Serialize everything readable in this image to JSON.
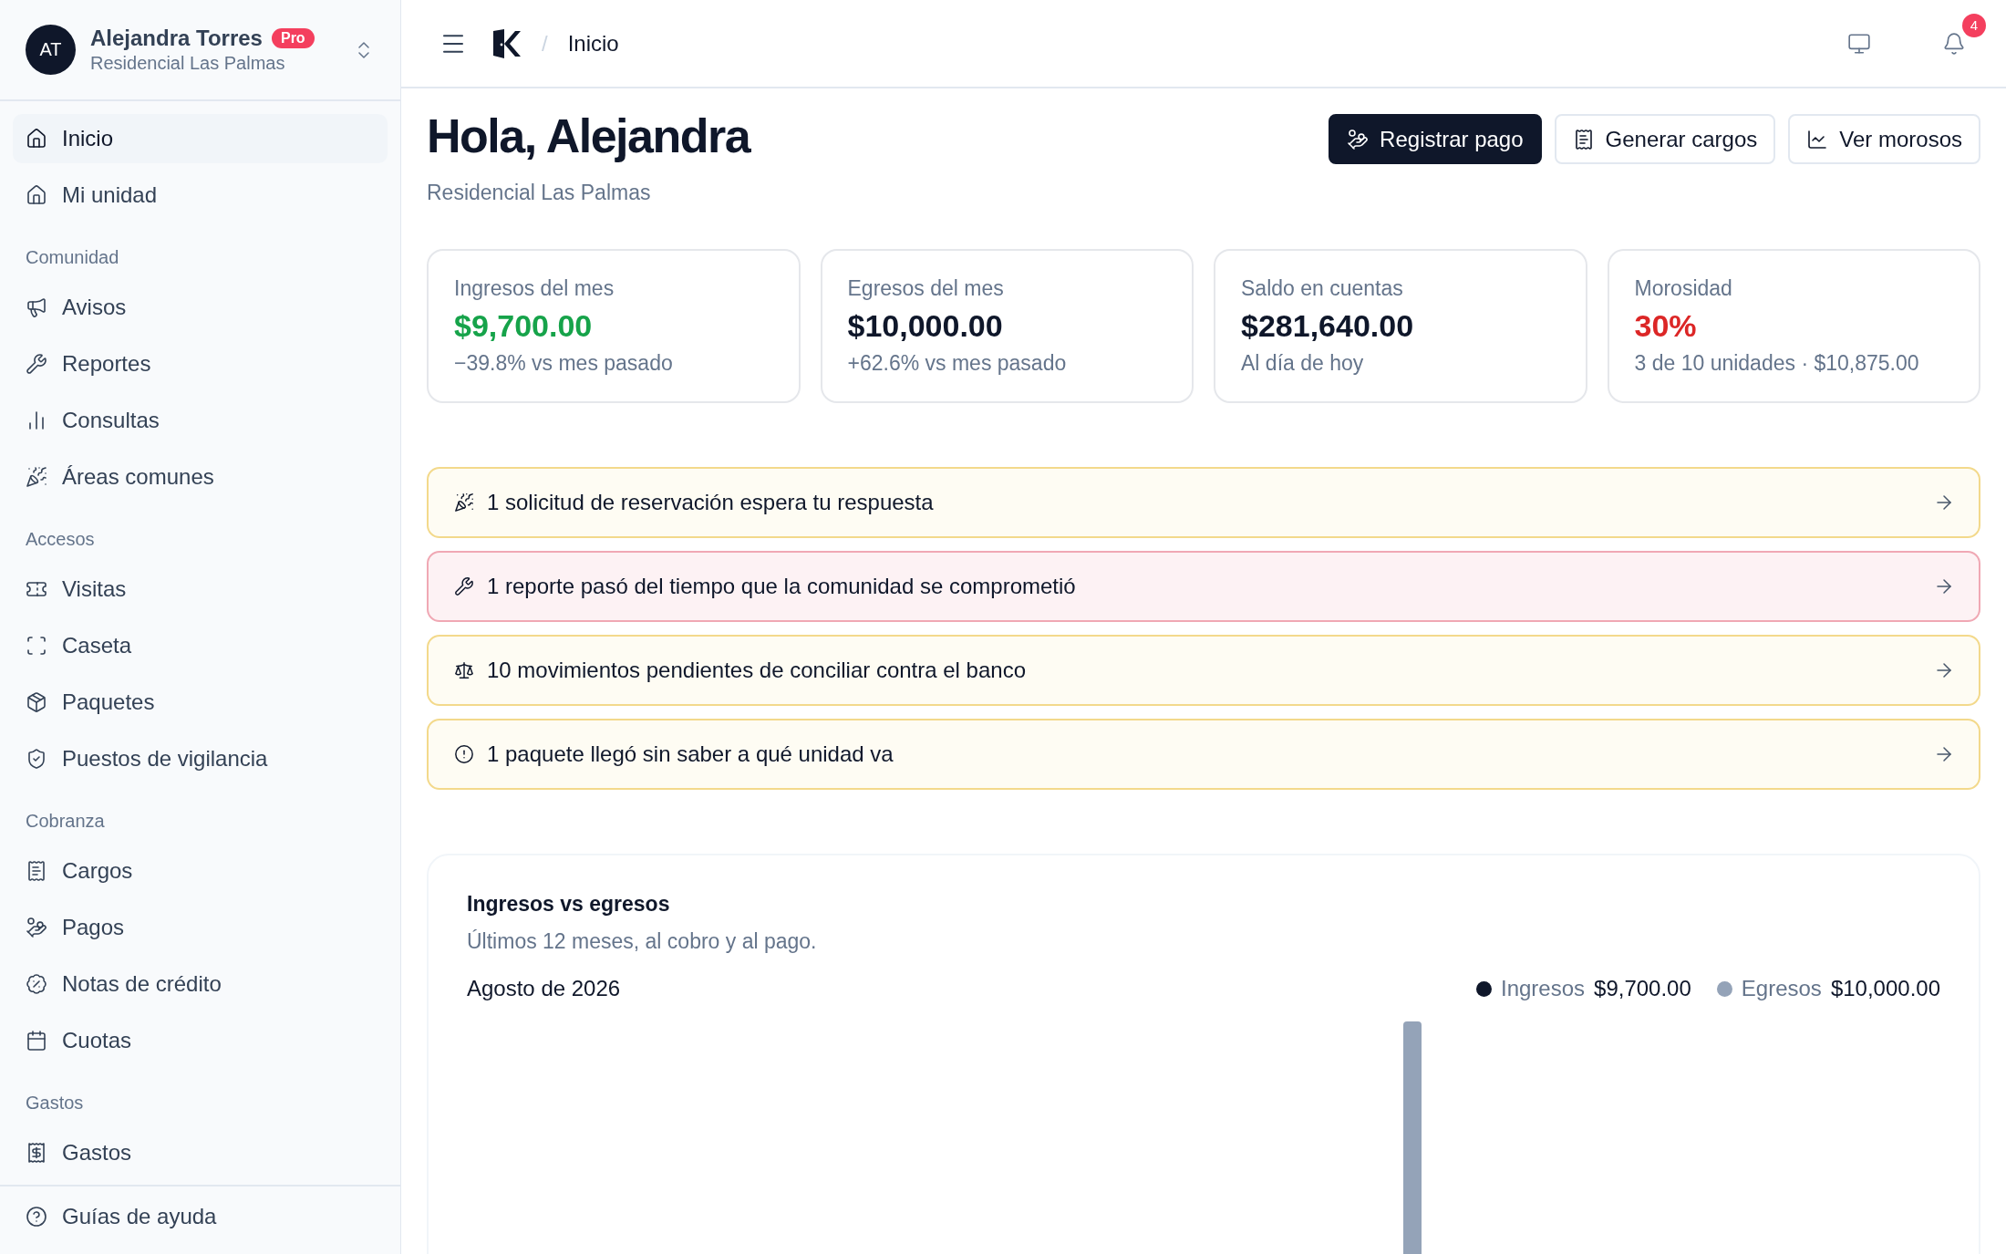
{
  "user": {
    "initials": "AT",
    "name": "Alejandra Torres",
    "badge": "Pro",
    "community": "Residencial Las Palmas"
  },
  "sidebar": {
    "top_items": [
      {
        "label": "Inicio",
        "selected": true
      },
      {
        "label": "Mi unidad",
        "selected": false
      }
    ],
    "sections": [
      {
        "title": "Comunidad",
        "items": [
          {
            "label": "Avisos",
            "selected": false
          },
          {
            "label": "Reportes",
            "selected": false
          },
          {
            "label": "Consultas",
            "selected": false
          },
          {
            "label": "Áreas comunes",
            "selected": false
          }
        ]
      },
      {
        "title": "Accesos",
        "items": [
          {
            "label": "Visitas",
            "selected": false
          },
          {
            "label": "Caseta",
            "selected": false
          },
          {
            "label": "Paquetes",
            "selected": false
          },
          {
            "label": "Puestos de vigilancia",
            "selected": false
          }
        ]
      },
      {
        "title": "Cobranza",
        "items": [
          {
            "label": "Cargos",
            "selected": false
          },
          {
            "label": "Pagos",
            "selected": false
          },
          {
            "label": "Notas de crédito",
            "selected": false
          },
          {
            "label": "Cuotas",
            "selected": false
          }
        ]
      },
      {
        "title": "Gastos",
        "items": [
          {
            "label": "Gastos",
            "selected": false
          }
        ]
      }
    ],
    "footer_item": {
      "label": "Guías de ayuda",
      "selected": false
    }
  },
  "topbar": {
    "separator": "/",
    "breadcrumb": "Inicio",
    "notifications": "4"
  },
  "page": {
    "title": "Hola, Alejandra",
    "subtitle": "Residencial Las Palmas",
    "actions": [
      {
        "label": "Registrar pago",
        "kind": "primary"
      },
      {
        "label": "Generar cargos",
        "kind": "secondary"
      },
      {
        "label": "Ver morosos",
        "kind": "secondary"
      }
    ]
  },
  "stats": [
    {
      "label": "Ingresos del mes",
      "value": "$9,700.00",
      "kind": "positive",
      "note": "−39.8% vs mes pasado"
    },
    {
      "label": "Egresos del mes",
      "value": "$10,000.00",
      "kind": "neutral",
      "note": "+62.6% vs mes pasado"
    },
    {
      "label": "Saldo en cuentas",
      "value": "$281,640.00",
      "kind": "neutral",
      "note": "Al día de hoy"
    },
    {
      "label": "Morosidad",
      "value": "30%",
      "kind": "negative",
      "note": "3 de 10 unidades · $10,875.00"
    }
  ],
  "alerts": [
    {
      "text": "1 solicitud de reservación espera tu respuesta",
      "kind": "warning"
    },
    {
      "text": "1 reporte pasó del tiempo que la comunidad se comprometió",
      "kind": "danger"
    },
    {
      "text": "10 movimientos pendientes de conciliar contra el banco",
      "kind": "warning"
    },
    {
      "text": "1 paquete llegó sin saber a qué unidad va",
      "kind": "warning"
    }
  ],
  "chart_card": {
    "title": "Ingresos vs egresos",
    "subtitle": "Últimos 12 meses, al cobro y al pago.",
    "period": "Agosto de 2026",
    "legend": [
      {
        "name": "Ingresos",
        "value": "$9,700.00",
        "color": "#0f172a"
      },
      {
        "name": "Egresos",
        "value": "$10,000.00",
        "color": "#94a3b8"
      }
    ]
  }
}
